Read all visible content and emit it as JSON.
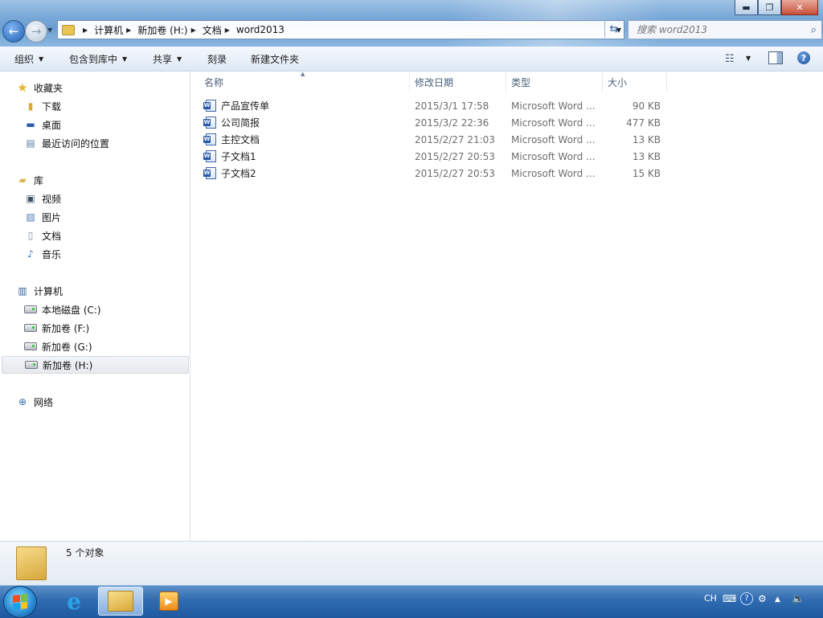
{
  "window": {
    "minimize_icon": "minimize-icon",
    "maximize_icon": "restore-icon",
    "close_icon": "close-icon"
  },
  "address": {
    "breadcrumbs": [
      "计算机",
      "新加卷 (H:)",
      "文档",
      "word2013"
    ]
  },
  "search": {
    "placeholder": "搜索 word2013"
  },
  "toolbar": {
    "organize": "组织",
    "include_in_library": "包含到库中",
    "share": "共享",
    "burn": "刻录",
    "new_folder": "新建文件夹"
  },
  "navpane": {
    "favorites": "收藏夹",
    "downloads": "下载",
    "desktop": "桌面",
    "recent": "最近访问的位置",
    "libraries": "库",
    "videos": "视频",
    "pictures": "图片",
    "documents": "文档",
    "music": "音乐",
    "computer": "计算机",
    "drive_c": "本地磁盘 (C:)",
    "drive_f": "新加卷 (F:)",
    "drive_g": "新加卷 (G:)",
    "drive_h": "新加卷 (H:)",
    "network": "网络"
  },
  "columns": {
    "name": "名称",
    "date": "修改日期",
    "type": "类型",
    "size": "大小"
  },
  "files": [
    {
      "name": "产品宣传单",
      "date": "2015/3/1 17:58",
      "type": "Microsoft Word ...",
      "size": "90 KB"
    },
    {
      "name": "公司简报",
      "date": "2015/3/2 22:36",
      "type": "Microsoft Word ...",
      "size": "477 KB"
    },
    {
      "name": "主控文档",
      "date": "2015/2/27 21:03",
      "type": "Microsoft Word ...",
      "size": "13 KB"
    },
    {
      "name": "子文档1",
      "date": "2015/2/27 20:53",
      "type": "Microsoft Word ...",
      "size": "13 KB"
    },
    {
      "name": "子文档2",
      "date": "2015/2/27 20:53",
      "type": "Microsoft Word ...",
      "size": "15 KB"
    }
  ],
  "status": {
    "count": "5 个对象"
  },
  "taskbar": {
    "language": "CH"
  }
}
